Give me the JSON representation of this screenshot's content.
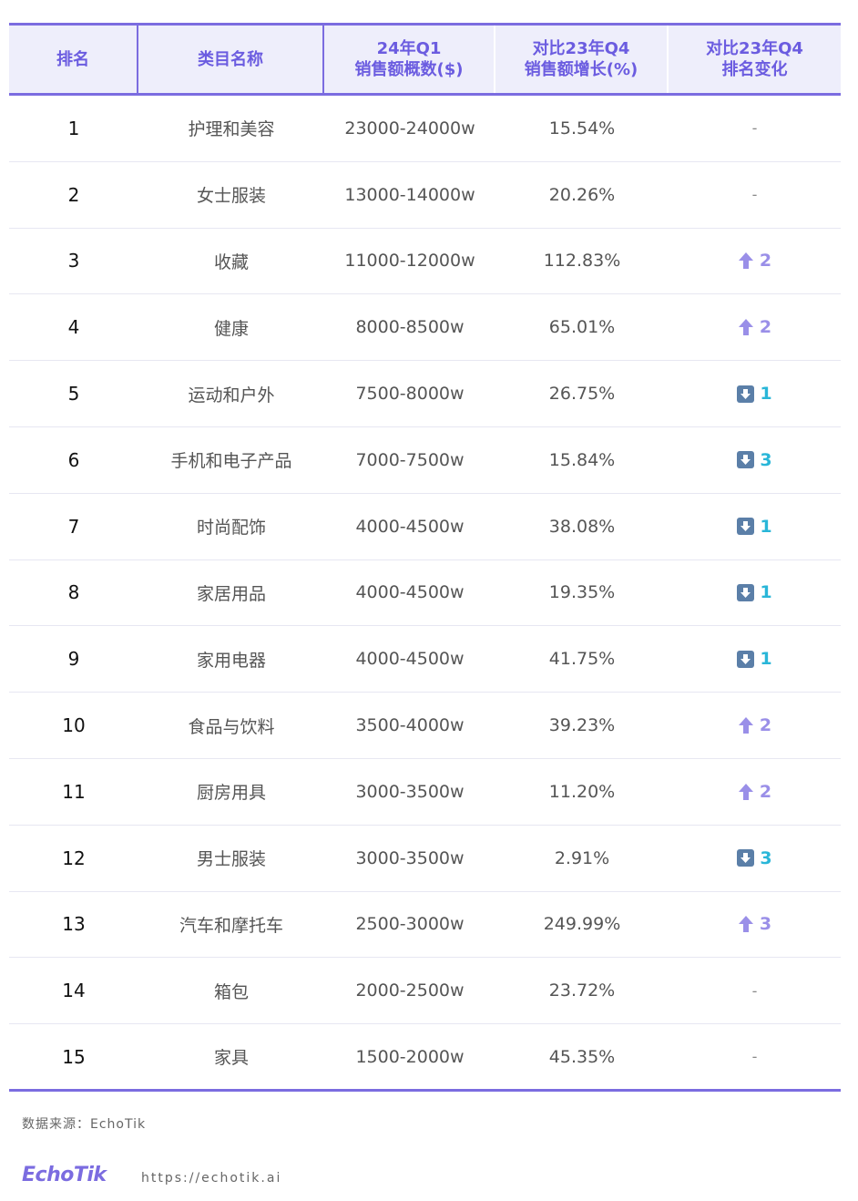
{
  "headers": [
    {
      "line1": "排名",
      "line2": ""
    },
    {
      "line1": "类目名称",
      "line2": ""
    },
    {
      "line1": "24年Q1",
      "line2": "销售额概数($)"
    },
    {
      "line1": "对比23年Q4",
      "line2": "销售额增长(%)"
    },
    {
      "line1": "对比23年Q4",
      "line2": "排名变化"
    }
  ],
  "rows": [
    {
      "rank": "1",
      "category": "护理和美容",
      "sales": "23000-24000w",
      "growth": "15.54%",
      "change_dir": "none",
      "change": "-"
    },
    {
      "rank": "2",
      "category": "女士服装",
      "sales": "13000-14000w",
      "growth": "20.26%",
      "change_dir": "none",
      "change": "-"
    },
    {
      "rank": "3",
      "category": "收藏",
      "sales": "11000-12000w",
      "growth": "112.83%",
      "change_dir": "up",
      "change": "2"
    },
    {
      "rank": "4",
      "category": "健康",
      "sales": "8000-8500w",
      "growth": "65.01%",
      "change_dir": "up",
      "change": "2"
    },
    {
      "rank": "5",
      "category": "运动和户外",
      "sales": "7500-8000w",
      "growth": "26.75%",
      "change_dir": "down",
      "change": "1"
    },
    {
      "rank": "6",
      "category": "手机和电子产品",
      "sales": "7000-7500w",
      "growth": "15.84%",
      "change_dir": "down",
      "change": "3"
    },
    {
      "rank": "7",
      "category": "时尚配饰",
      "sales": "4000-4500w",
      "growth": "38.08%",
      "change_dir": "down",
      "change": "1"
    },
    {
      "rank": "8",
      "category": "家居用品",
      "sales": "4000-4500w",
      "growth": "19.35%",
      "change_dir": "down",
      "change": "1"
    },
    {
      "rank": "9",
      "category": "家用电器",
      "sales": "4000-4500w",
      "growth": "41.75%",
      "change_dir": "down",
      "change": "1"
    },
    {
      "rank": "10",
      "category": "食品与饮料",
      "sales": "3500-4000w",
      "growth": "39.23%",
      "change_dir": "up",
      "change": "2"
    },
    {
      "rank": "11",
      "category": "厨房用具",
      "sales": "3000-3500w",
      "growth": "11.20%",
      "change_dir": "up",
      "change": "2"
    },
    {
      "rank": "12",
      "category": "男士服装",
      "sales": "3000-3500w",
      "growth": "2.91%",
      "change_dir": "down",
      "change": "3"
    },
    {
      "rank": "13",
      "category": "汽车和摩托车",
      "sales": "2500-3000w",
      "growth": "249.99%",
      "change_dir": "up",
      "change": "3"
    },
    {
      "rank": "14",
      "category": "箱包",
      "sales": "2000-2500w",
      "growth": "23.72%",
      "change_dir": "none",
      "change": "-"
    },
    {
      "rank": "15",
      "category": "家具",
      "sales": "1500-2000w",
      "growth": "45.35%",
      "change_dir": "none",
      "change": "-"
    }
  ],
  "footer": {
    "source": "数据来源：EchoTik",
    "logo": "EchoTik",
    "url": "https://echotik.ai"
  },
  "colors": {
    "accent": "#7b6ce0",
    "up": "#9a8fe8",
    "down": "#29b6d8",
    "header_bg": "#eeeefb"
  },
  "icons": {
    "up": "arrow-up-icon",
    "down": "arrow-down-box-icon"
  }
}
